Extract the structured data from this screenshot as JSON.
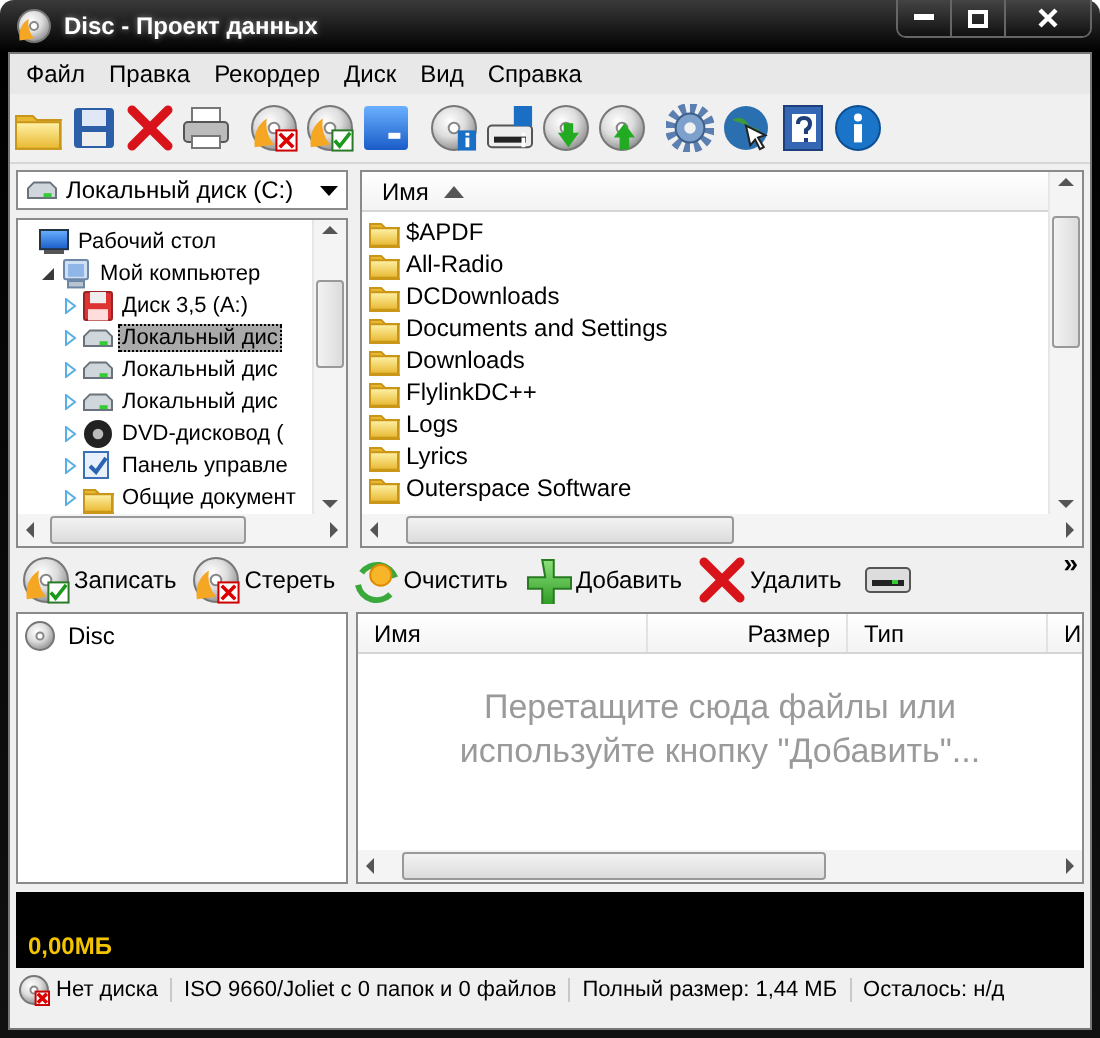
{
  "window": {
    "title": "Disc - Проект данных"
  },
  "menu": [
    "Файл",
    "Правка",
    "Рекордер",
    "Диск",
    "Вид",
    "Справка"
  ],
  "drive_select": {
    "value": "Локальный диск (C:)"
  },
  "tree": [
    {
      "label": "Рабочий стол",
      "kind": "desktop",
      "selected": false,
      "children": [
        {
          "label": "Мой компьютер",
          "kind": "computer",
          "expanded": true,
          "selected": false,
          "children": [
            {
              "label": "Диск 3,5 (A:)",
              "kind": "floppy",
              "expanded": false,
              "selected": false
            },
            {
              "label": "Локальный дис",
              "kind": "drive",
              "expanded": false,
              "selected": true
            },
            {
              "label": "Локальный дис",
              "kind": "drive",
              "expanded": false,
              "selected": false
            },
            {
              "label": "Локальный дис",
              "kind": "drive",
              "expanded": false,
              "selected": false
            },
            {
              "label": "DVD-дисковод (",
              "kind": "dvd",
              "expanded": false,
              "selected": false
            },
            {
              "label": "Панель управле",
              "kind": "panel",
              "expanded": false,
              "selected": false
            },
            {
              "label": "Общие документ",
              "kind": "folder",
              "expanded": false,
              "selected": false
            }
          ]
        }
      ]
    }
  ],
  "files": {
    "columns": [
      {
        "label": "Имя",
        "sorted": true
      }
    ],
    "rows": [
      "$APDF",
      "All-Radio",
      "DCDownloads",
      "Documents and Settings",
      "Downloads",
      "FlylinkDC++",
      "Logs",
      "Lyrics",
      "Outerspace Software"
    ]
  },
  "actions": [
    {
      "label": "Записать",
      "kind": "burn"
    },
    {
      "label": "Стереть",
      "kind": "erase"
    },
    {
      "label": "Очистить",
      "kind": "clear"
    },
    {
      "label": "Добавить",
      "kind": "add"
    },
    {
      "label": "Удалить",
      "kind": "remove"
    }
  ],
  "overflow": "»",
  "disc_tree": [
    {
      "label": "Disc"
    }
  ],
  "project_list": {
    "columns": [
      "Имя",
      "Размер",
      "Тип",
      "И"
    ],
    "hint": "Перетащите сюда файлы или используйте кнопку \"Добавить\"..."
  },
  "size_bar": {
    "text": "0,00МБ"
  },
  "status_bar": [
    "Нет диска",
    "ISO 9660/Joliet с 0 папок и 0 файлов",
    "Полный размер: 1,44 МБ",
    "Осталось: н/д"
  ]
}
